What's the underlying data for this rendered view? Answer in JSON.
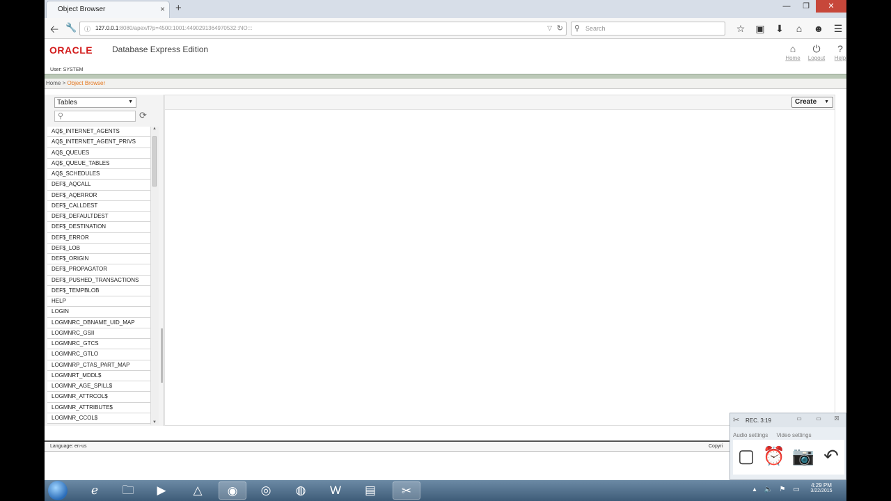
{
  "browser": {
    "tab_title": "Object Browser",
    "tab_close": "×",
    "new_tab": "+",
    "url_host": "127.0.0.1",
    "url_rest": ":8080/apex/f?p=4500:1001:4490291364970532::NO:::",
    "search_placeholder": "Search"
  },
  "header": {
    "brand": "ORACLE",
    "title": "Database Express Edition",
    "user_line": "User: SYSTEM",
    "links": [
      {
        "label": "Home",
        "icon": "home-icon"
      },
      {
        "label": "Logout",
        "icon": "logout-icon"
      },
      {
        "label": "Help",
        "icon": "help-icon"
      }
    ]
  },
  "breadcrumb": {
    "home": "Home",
    "separator": " > ",
    "current": "Object Browser"
  },
  "object_browser": {
    "type_selected": "Tables",
    "items": [
      "AQ$_INTERNET_AGENTS",
      "AQ$_INTERNET_AGENT_PRIVS",
      "AQ$_QUEUES",
      "AQ$_QUEUE_TABLES",
      "AQ$_SCHEDULES",
      "DEF$_AQCALL",
      "DEF$_AQERROR",
      "DEF$_CALLDEST",
      "DEF$_DEFAULTDEST",
      "DEF$_DESTINATION",
      "DEF$_ERROR",
      "DEF$_LOB",
      "DEF$_ORIGIN",
      "DEF$_PROPAGATOR",
      "DEF$_PUSHED_TRANSACTIONS",
      "DEF$_TEMPBLOB",
      "HELP",
      "LOGIN",
      "LOGMNRC_DBNAME_UID_MAP",
      "LOGMNRC_GSII",
      "LOGMNRC_GTCS",
      "LOGMNRC_GTLO",
      "LOGMNRP_CTAS_PART_MAP",
      "LOGMNRT_MDDL$",
      "LOGMNR_AGE_SPILL$",
      "LOGMNR_ATTRCOL$",
      "LOGMNR_ATTRIBUTE$",
      "LOGMNR_CCOL$"
    ]
  },
  "main": {
    "create_label": "Create"
  },
  "footer": {
    "language": "Language: en-us",
    "copyright": "Copyri"
  },
  "recorder": {
    "time": "REC. 3:19",
    "tab_audio": "Audio settings",
    "tab_video": "Video settings"
  },
  "taskbar": {
    "clock_time": "4:29 PM",
    "clock_date": "3/22/2015"
  },
  "colors": {
    "oracle_red": "#d21a1a",
    "breadcrumb_current": "#e5771e",
    "header_band": "#bcc9b8"
  }
}
